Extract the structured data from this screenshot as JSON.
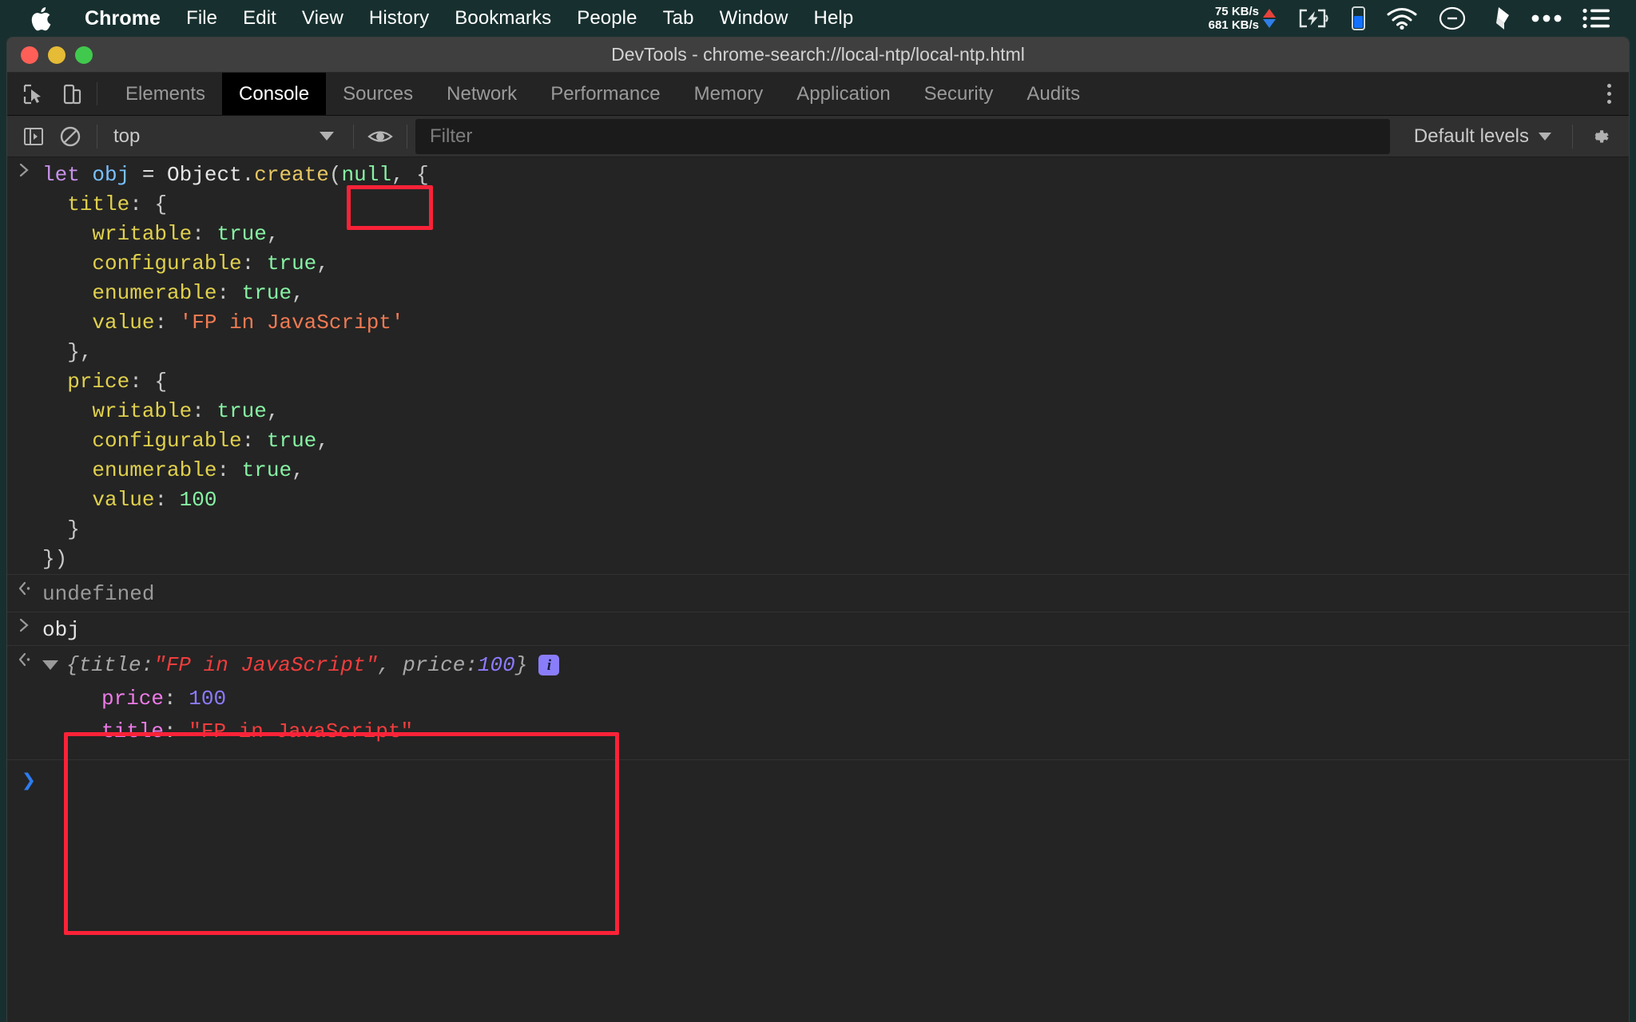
{
  "menubar": {
    "apple_icon": "apple-logo-icon",
    "items": [
      {
        "label": "Chrome",
        "bold": true
      },
      {
        "label": "File",
        "bold": false
      },
      {
        "label": "Edit",
        "bold": false
      },
      {
        "label": "View",
        "bold": false
      },
      {
        "label": "History",
        "bold": false
      },
      {
        "label": "Bookmarks",
        "bold": false
      },
      {
        "label": "People",
        "bold": false
      },
      {
        "label": "Tab",
        "bold": false
      },
      {
        "label": "Window",
        "bold": false
      },
      {
        "label": "Help",
        "bold": false
      }
    ],
    "network": {
      "upload": "75 KB/s",
      "download": "681 KB/s",
      "up_color": "#e8413a",
      "down_color": "#2f7ee8"
    },
    "status_icons": [
      "battery-charging-icon",
      "battery-level-icon",
      "wifi-icon",
      "do-not-disturb-icon",
      "dropbox-icon",
      "ellipsis-icon",
      "menu-list-icon"
    ],
    "bg_color": "#17302f"
  },
  "window": {
    "title": "DevTools - chrome-search://local-ntp/local-ntp.html",
    "traffic_lights": [
      "close",
      "minimize",
      "zoom"
    ]
  },
  "devtools": {
    "left_tools": [
      "inspect-element-icon",
      "device-toolbar-icon"
    ],
    "tabs": [
      {
        "label": "Elements",
        "active": false
      },
      {
        "label": "Console",
        "active": true
      },
      {
        "label": "Sources",
        "active": false
      },
      {
        "label": "Network",
        "active": false
      },
      {
        "label": "Performance",
        "active": false
      },
      {
        "label": "Memory",
        "active": false
      },
      {
        "label": "Application",
        "active": false
      },
      {
        "label": "Security",
        "active": false
      },
      {
        "label": "Audits",
        "active": false
      }
    ],
    "more_icon": "kebab-menu-icon"
  },
  "console_toolbar": {
    "sidebar_toggle_icon": "console-sidebar-icon",
    "clear_icon": "clear-console-icon",
    "context": "top",
    "context_caret": "chevron-down-icon",
    "eye_icon": "live-expression-eye-icon",
    "filter_placeholder": "Filter",
    "filter_value": "",
    "levels_label": "Default levels",
    "levels_caret": "chevron-down-icon",
    "settings_icon": "gear-icon"
  },
  "console": {
    "entries": [
      {
        "kind": "input",
        "marker": "input-chevron-icon",
        "lines": [
          [
            {
              "t": "let ",
              "c": "t-kw"
            },
            {
              "t": "obj ",
              "c": "t-var"
            },
            {
              "t": "= ",
              "c": "t-plain"
            },
            {
              "t": "Object",
              "c": "t-plain"
            },
            {
              "t": ".",
              "c": "t-punc"
            },
            {
              "t": "create",
              "c": "t-fn"
            },
            {
              "t": "(",
              "c": "t-punc"
            },
            {
              "t": "null",
              "c": "t-null"
            },
            {
              "t": ", ",
              "c": "t-punc"
            },
            {
              "t": "{",
              "c": "t-punc"
            }
          ],
          [
            {
              "t": "  title",
              "c": "t-prop"
            },
            {
              "t": ": ",
              "c": "t-punc"
            },
            {
              "t": "{",
              "c": "t-punc"
            }
          ],
          [
            {
              "t": "    writable",
              "c": "t-prop"
            },
            {
              "t": ": ",
              "c": "t-punc"
            },
            {
              "t": "true",
              "c": "t-bool"
            },
            {
              "t": ",",
              "c": "t-punc"
            }
          ],
          [
            {
              "t": "    configurable",
              "c": "t-prop"
            },
            {
              "t": ": ",
              "c": "t-punc"
            },
            {
              "t": "true",
              "c": "t-bool"
            },
            {
              "t": ",",
              "c": "t-punc"
            }
          ],
          [
            {
              "t": "    enumerable",
              "c": "t-prop"
            },
            {
              "t": ": ",
              "c": "t-punc"
            },
            {
              "t": "true",
              "c": "t-bool"
            },
            {
              "t": ",",
              "c": "t-punc"
            }
          ],
          [
            {
              "t": "    value",
              "c": "t-prop"
            },
            {
              "t": ": ",
              "c": "t-punc"
            },
            {
              "t": "'FP in JavaScript'",
              "c": "t-str"
            }
          ],
          [
            {
              "t": "  }",
              "c": "t-punc"
            },
            {
              "t": ",",
              "c": "t-punc"
            }
          ],
          [
            {
              "t": "  price",
              "c": "t-prop"
            },
            {
              "t": ": ",
              "c": "t-punc"
            },
            {
              "t": "{",
              "c": "t-punc"
            }
          ],
          [
            {
              "t": "    writable",
              "c": "t-prop"
            },
            {
              "t": ": ",
              "c": "t-punc"
            },
            {
              "t": "true",
              "c": "t-bool"
            },
            {
              "t": ",",
              "c": "t-punc"
            }
          ],
          [
            {
              "t": "    configurable",
              "c": "t-prop"
            },
            {
              "t": ": ",
              "c": "t-punc"
            },
            {
              "t": "true",
              "c": "t-bool"
            },
            {
              "t": ",",
              "c": "t-punc"
            }
          ],
          [
            {
              "t": "    enumerable",
              "c": "t-prop"
            },
            {
              "t": ": ",
              "c": "t-punc"
            },
            {
              "t": "true",
              "c": "t-bool"
            },
            {
              "t": ",",
              "c": "t-punc"
            }
          ],
          [
            {
              "t": "    value",
              "c": "t-prop"
            },
            {
              "t": ": ",
              "c": "t-punc"
            },
            {
              "t": "100",
              "c": "t-num"
            }
          ],
          [
            {
              "t": "  }",
              "c": "t-punc"
            }
          ],
          [
            {
              "t": "})",
              "c": "t-punc"
            }
          ]
        ]
      },
      {
        "kind": "result-undefined",
        "marker": "result-chevron-icon",
        "text": "undefined"
      },
      {
        "kind": "input",
        "marker": "input-chevron-icon",
        "lines": [
          [
            {
              "t": "obj",
              "c": "t-plain"
            }
          ]
        ]
      },
      {
        "kind": "result-object",
        "marker": "result-chevron-icon",
        "disclosure": "triangle-down-icon",
        "preview": [
          {
            "t": "{",
            "c": "o-dim"
          },
          {
            "t": "title",
            "c": "o-dim"
          },
          {
            "t": ": ",
            "c": "o-dim"
          },
          {
            "t": "\"FP in JavaScript\"",
            "c": "o-str"
          },
          {
            "t": ", ",
            "c": "o-dim"
          },
          {
            "t": "price",
            "c": "o-dim"
          },
          {
            "t": ": ",
            "c": "o-dim"
          },
          {
            "t": "100",
            "c": "o-num"
          },
          {
            "t": "}",
            "c": "o-dim"
          }
        ],
        "info_badge": "i",
        "properties": [
          [
            {
              "t": "price",
              "c": "p-key"
            },
            {
              "t": ": ",
              "c": "p-punc"
            },
            {
              "t": "100",
              "c": "p-num"
            }
          ],
          [
            {
              "t": "title",
              "c": "p-key"
            },
            {
              "t": ": ",
              "c": "p-punc"
            },
            {
              "t": "\"FP in JavaScript\"",
              "c": "p-str"
            }
          ]
        ]
      }
    ],
    "prompt": {
      "chevron": "❯",
      "value": ""
    }
  },
  "annotations": [
    {
      "name": "highlight-null-argument",
      "color": "#fa2238"
    },
    {
      "name": "highlight-console-prompt",
      "color": "#fa2238"
    }
  ]
}
